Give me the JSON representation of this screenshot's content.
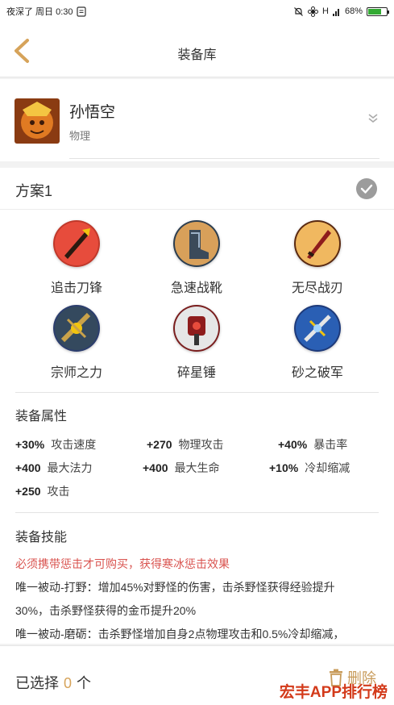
{
  "status_bar": {
    "left_text": "夜深了 周日 0:30",
    "battery": "68%",
    "signal_text": "H"
  },
  "nav": {
    "title": "装备库"
  },
  "hero": {
    "name": "孙悟空",
    "role": "物理"
  },
  "plan": {
    "label": "方案1"
  },
  "items": [
    {
      "name": "追击刀锋",
      "color": "#c0392b"
    },
    {
      "name": "急速战靴",
      "color": "#34495e"
    },
    {
      "name": "无尽战刃",
      "color": "#6e2c1e"
    },
    {
      "name": "宗师之力",
      "color": "#2c3e6e"
    },
    {
      "name": "碎星锤",
      "color": "#7a1e1e"
    },
    {
      "name": "砂之破军",
      "color": "#1e3a7a"
    }
  ],
  "attributes": {
    "title": "装备属性",
    "rows": [
      [
        {
          "value": "+30%",
          "label": "攻击速度"
        },
        {
          "value": "+270",
          "label": "物理攻击"
        },
        {
          "value": "+40%",
          "label": "暴击率"
        }
      ],
      [
        {
          "value": "+400",
          "label": "最大法力"
        },
        {
          "value": "+400",
          "label": "最大生命"
        },
        {
          "value": "+10%",
          "label": "冷却缩减"
        }
      ],
      [
        {
          "value": "+250",
          "label": "攻击"
        }
      ]
    ]
  },
  "skills": {
    "title": "装备技能",
    "requirement": "必须携带惩击才可购买，获得寒冰惩击效果",
    "line1": "唯一被动-打野：增加45%对野怪的伤害，击杀野怪获得经验提升",
    "line2": "30%，击杀野怪获得的金币提升20%",
    "line3": "唯一被动-磨砺：击杀野怪增加自身2点物理攻击和0.5%冷却缩减，"
  },
  "bottom": {
    "selected_prefix": "已选择",
    "selected_count": "0",
    "selected_suffix": "个",
    "delete_label": "删除",
    "watermark": "宏丰APP排行榜"
  },
  "colors": {
    "accent": "#d6a35a",
    "warning": "#d9534f",
    "check": "#9c9c9c"
  }
}
